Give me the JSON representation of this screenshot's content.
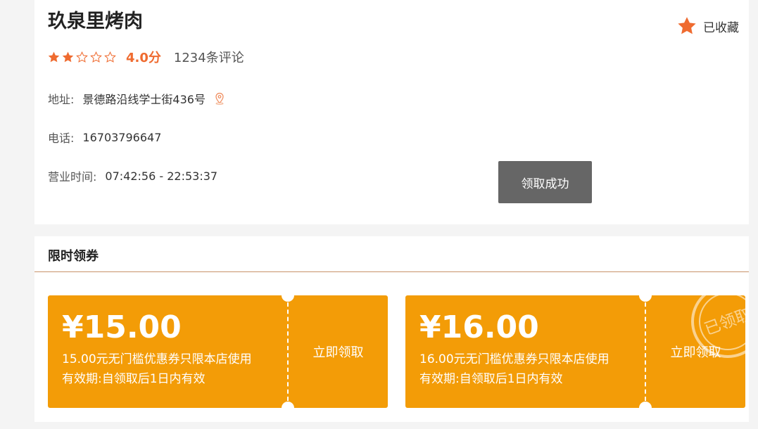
{
  "shop": {
    "name": "玖泉里烤肉",
    "rating_stars": 2,
    "rating_max": 5,
    "score": "4.0分",
    "reviews": "1234条评论",
    "address_label": "地址:",
    "address": "景德路沿线学士街436号",
    "phone_label": "电话:",
    "phone": "16703796647",
    "hours_label": "营业时间:",
    "hours": "07:42:56 - 22:53:37",
    "favorite_label": "已收藏",
    "claim_button": "领取成功"
  },
  "coupons_section": {
    "title": "限时领券",
    "coupons": [
      {
        "amount": "¥15.00",
        "desc": "15.00元无门槛优惠券只限本店使用",
        "validity": "有效期:自领取后1日内有效",
        "action": "立即领取",
        "claimed": false
      },
      {
        "amount": "¥16.00",
        "desc": "16.00元无门槛优惠券只限本店使用",
        "validity": "有效期:自领取后1日内有效",
        "action": "立即领取",
        "claimed": true,
        "stamp": "已领取"
      }
    ]
  },
  "colors": {
    "accent": "#ef6b30",
    "coupon": "#f39c07",
    "claim_button": "#666666",
    "section_line": "#c8936a"
  },
  "icons": [
    "star-filled-icon",
    "star-outline-icon",
    "location-pin-icon",
    "favorite-star-icon",
    "claimed-stamp-icon"
  ]
}
